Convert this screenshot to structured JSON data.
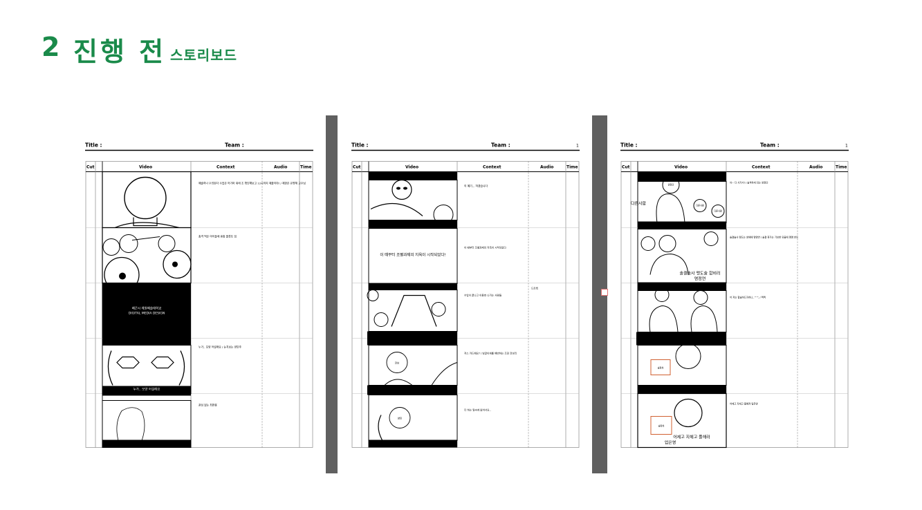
{
  "header": {
    "number": "2",
    "title": "진행 전",
    "subtitle": "스토리보드"
  },
  "sheet_labels": {
    "title": "Title :",
    "team": "Team :",
    "page": "1"
  },
  "columns": [
    "Cut",
    "Video",
    "Context",
    "Audio",
    "Time"
  ],
  "sheets": [
    {
      "name": "sheet-1",
      "rows": [
        {
          "context": "예술하나 수의된다 수업은 어기마 위에 조 확인해보고 12시까지 제출이야! / 제한은 유명체 교수님",
          "audio": ""
        },
        {
          "context": "총격 먹은 아이들에 휴종 플롯트 임",
          "audio": ""
        },
        {
          "context": "",
          "audio": ""
        },
        {
          "context": "누가.. 모양 어설래요 / 눈치보는 양민주",
          "audio": ""
        },
        {
          "context": "관심 없는 최현용",
          "audio": ""
        }
      ],
      "frame_texts": {
        "logo_line1": "배곤시 계원예술대학교",
        "logo_line2": "DIGITAL MEDIA DESIGN",
        "caption": "누가.. 모양 어설래요"
      }
    },
    {
      "name": "sheet-2",
      "rows": [
        {
          "context": "이 예기... 하겠습니다",
          "audio": ""
        },
        {
          "context": "이 때부터 조별과제의 지옥이 시작되었다",
          "audio": ""
        },
        {
          "context": "수업이 끝나고 이용호 나가는 사람들",
          "audio": "드르륵"
        },
        {
          "context": "저스 카드해요? / 빙글이게를 해번하는 조장 전보리",
          "audio": ""
        },
        {
          "context": "더 하는 말씨게 없어서요..",
          "audio": ""
        }
      ],
      "frame_texts": {
        "banner": "이 때부터 조별과제의 지옥이 시작되었다!",
        "face1": "전보",
        "face2": "양민"
      }
    },
    {
      "name": "sheet-3",
      "rows": [
        {
          "context": "아~ 다 사가서! / 솔격하게 되는 양정인",
          "audio": ""
        },
        {
          "context": "솔결솔사 맹도는 양에에 명명연 / 솔결 휴가는 기보한 유출에 맹명 반도",
          "audio": ""
        },
        {
          "context": "어 저는 합솔하드자하니..^^; / 쩍쩍",
          "audio": ""
        },
        {
          "context": "",
          "audio": ""
        },
        {
          "context": "어제고 자체고 플해져 업은영",
          "audio": ""
        }
      ],
      "frame_texts": {
        "left_label": "다른사람",
        "bubble1": "양정인",
        "bubble2": "다른사람",
        "bubble3": "다른사람",
        "caption1": "솔결솔사 맹도술 합비러",
        "caption1b": "명정연",
        "caption2": "어제고 자체고 플해러",
        "caption2b": "업은영",
        "screen": "솔파하"
      }
    }
  ]
}
